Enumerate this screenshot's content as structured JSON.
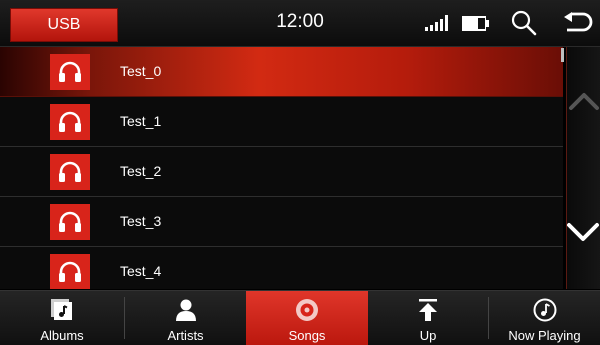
{
  "header": {
    "source_label": "USB",
    "time": "12:00"
  },
  "songs": [
    {
      "title": "Test_0"
    },
    {
      "title": "Test_1"
    },
    {
      "title": "Test_2"
    },
    {
      "title": "Test_3"
    },
    {
      "title": "Test_4"
    }
  ],
  "selected_index": 0,
  "tabs": [
    {
      "label": "Albums",
      "icon": "album-icon"
    },
    {
      "label": "Artists",
      "icon": "artist-icon"
    },
    {
      "label": "Songs",
      "icon": "song-disc-icon"
    },
    {
      "label": "Up",
      "icon": "up-arrow-icon"
    },
    {
      "label": "Now Playing",
      "icon": "now-playing-icon"
    }
  ],
  "colors": {
    "accent": "#d8241a",
    "background": "#0b0b0b"
  }
}
